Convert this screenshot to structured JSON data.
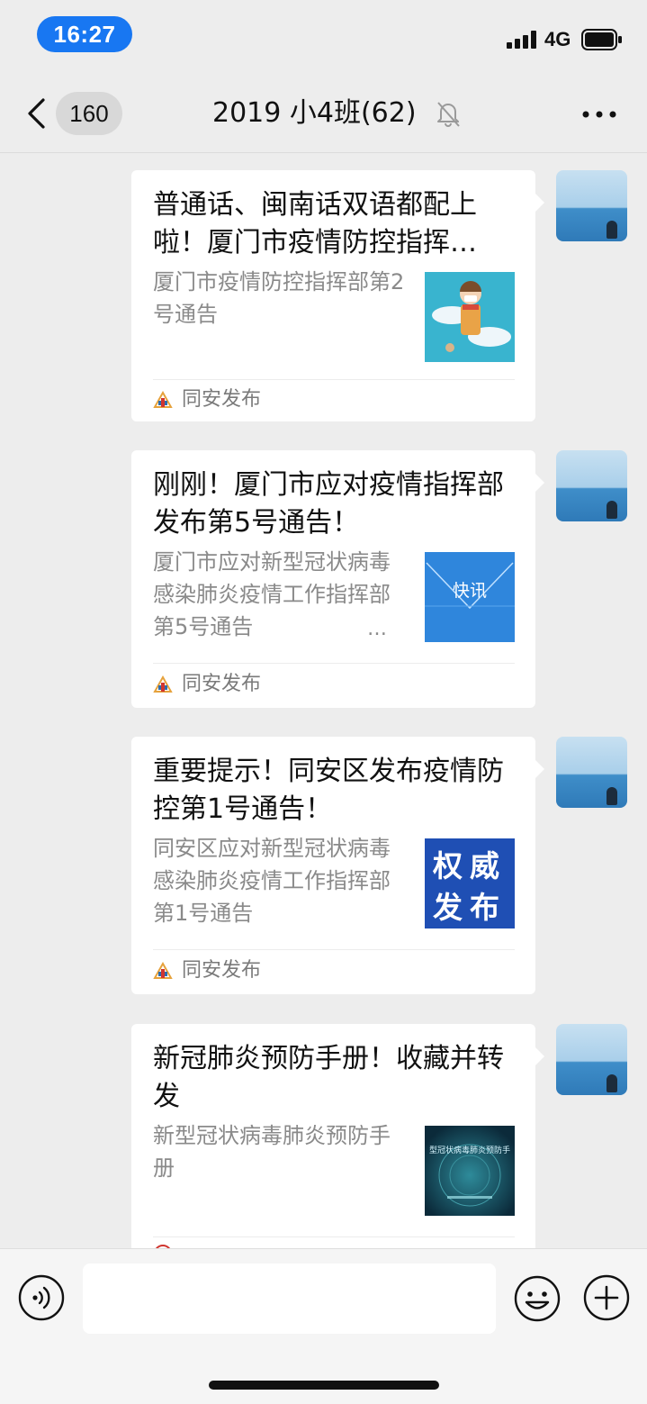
{
  "status_bar": {
    "time": "16:27",
    "network": "4G"
  },
  "nav": {
    "back_count": "160",
    "title": "2019 小4班(62)"
  },
  "messages": [
    {
      "title": "普通话、闽南话双语都配上啦！厦门市疫情防控指挥…",
      "desc": "厦门市疫情防控指挥部第2号通告",
      "source": "同安发布",
      "thumb": "cartoon-child-mask-thumbnail"
    },
    {
      "title": "刚刚！厦门市应对疫情指挥部发布第5号通告！",
      "desc": "厦门市应对新型冠状病毒感染肺炎疫情工作指挥部第5号通告",
      "desc_ellipsis": "…",
      "source": "同安发布",
      "thumb_text": "快讯"
    },
    {
      "title": "重要提示！同安区发布疫情防控第1号通告！",
      "desc": "同安区应对新型冠状病毒感染肺炎疫情工作指挥部第1号通告",
      "source": "同安发布",
      "thumb_text": "权威发布"
    },
    {
      "title": "新冠肺炎预防手册！收藏并转发",
      "desc": "新型冠状病毒肺炎预防手册",
      "thumb_text": "型冠状病毒肺炎预防手"
    }
  ],
  "input": {
    "placeholder": ""
  },
  "colors": {
    "time_pill": "#1877f2",
    "background": "#ededed",
    "card": "#ffffff"
  }
}
